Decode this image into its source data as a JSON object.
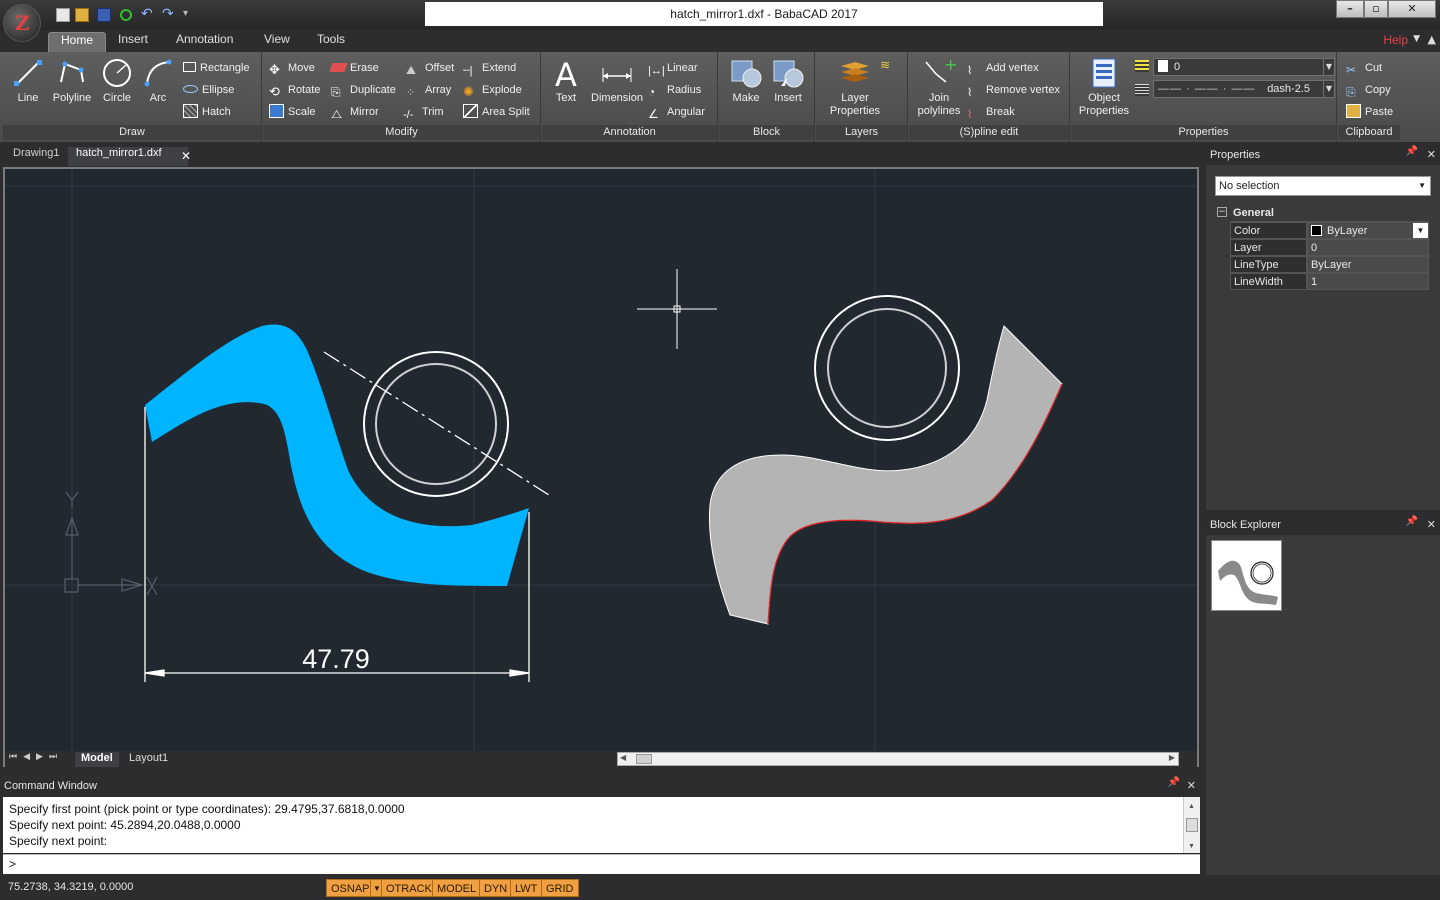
{
  "window": {
    "title": "hatch_mirror1.dxf - BabaCAD 2017",
    "app_logo_letter": "Z",
    "min": "–",
    "max": "▫",
    "close": "✕"
  },
  "ribbon_tabs": [
    "Home",
    "Insert",
    "Annotation",
    "View",
    "Tools"
  ],
  "help_label": "Help",
  "ribbon": {
    "draw": {
      "label": "Draw",
      "line": "Line",
      "polyline": "Polyline",
      "circle": "Circle",
      "arc": "Arc",
      "rectangle": "Rectangle",
      "ellipse": "Ellipse",
      "hatch": "Hatch"
    },
    "modify": {
      "label": "Modify",
      "move": "Move",
      "erase": "Erase",
      "offset": "Offset",
      "extend": "Extend",
      "rotate": "Rotate",
      "duplicate": "Duplicate",
      "array": "Array",
      "explode": "Explode",
      "scale": "Scale",
      "mirror": "Mirror",
      "trim": "Trim",
      "area_split": "Area Split"
    },
    "annotation": {
      "label": "Annotation",
      "text": "Text",
      "dimension": "Dimension",
      "linear": "Linear",
      "radius": "Radius",
      "angular": "Angular"
    },
    "block": {
      "label": "Block",
      "make": "Make",
      "insert": "Insert"
    },
    "layers": {
      "label": "Layers",
      "layer_properties_1": "Layer",
      "layer_properties_2": "Properties"
    },
    "spline": {
      "label": "(S)pline edit",
      "join_1": "Join",
      "join_2": "polylines",
      "add_vertex": "Add vertex",
      "remove_vertex": "Remove vertex",
      "break": "Break"
    },
    "properties": {
      "label": "Properties",
      "object_1": "Object",
      "object_2": "Properties",
      "layer_value": "0",
      "linetype_value": "dash-2.5"
    },
    "clipboard": {
      "label": "Clipboard",
      "cut": "Cut",
      "copy": "Copy",
      "paste": "Paste"
    }
  },
  "doc_tabs": [
    "Drawing1",
    "hatch_mirror1.dxf"
  ],
  "drawing": {
    "dimension_text": "47.79"
  },
  "layout_tabs": [
    "Model",
    "Layout1"
  ],
  "command_window": {
    "title": "Command Window",
    "lines": [
      "Specify first point (pick point or type coordinates): 29.4795,37.6818,0.0000",
      "Specify next point: 45.2894,20.0488,0.0000",
      "Specify next point:"
    ],
    "prompt": ">"
  },
  "status": {
    "coords": "75.2738, 34.3219, 0.0000",
    "buttons": [
      "OSNAP",
      "OTRACK",
      "MODEL",
      "DYN",
      "LWT",
      "GRID"
    ]
  },
  "properties_panel": {
    "title": "Properties",
    "selection": "No selection",
    "section": "General",
    "rows": [
      {
        "key": "Color",
        "value": "ByLayer"
      },
      {
        "key": "Layer",
        "value": "0"
      },
      {
        "key": "LineType",
        "value": "ByLayer"
      },
      {
        "key": "LineWidth",
        "value": "1"
      }
    ]
  },
  "block_explorer": {
    "title": "Block Explorer"
  },
  "colors": {
    "hatch_blue": "#00b4ff",
    "hatch_gray": "#b4b4b4",
    "status_orange": "#f0a040",
    "canvas_bg": "#212830"
  }
}
